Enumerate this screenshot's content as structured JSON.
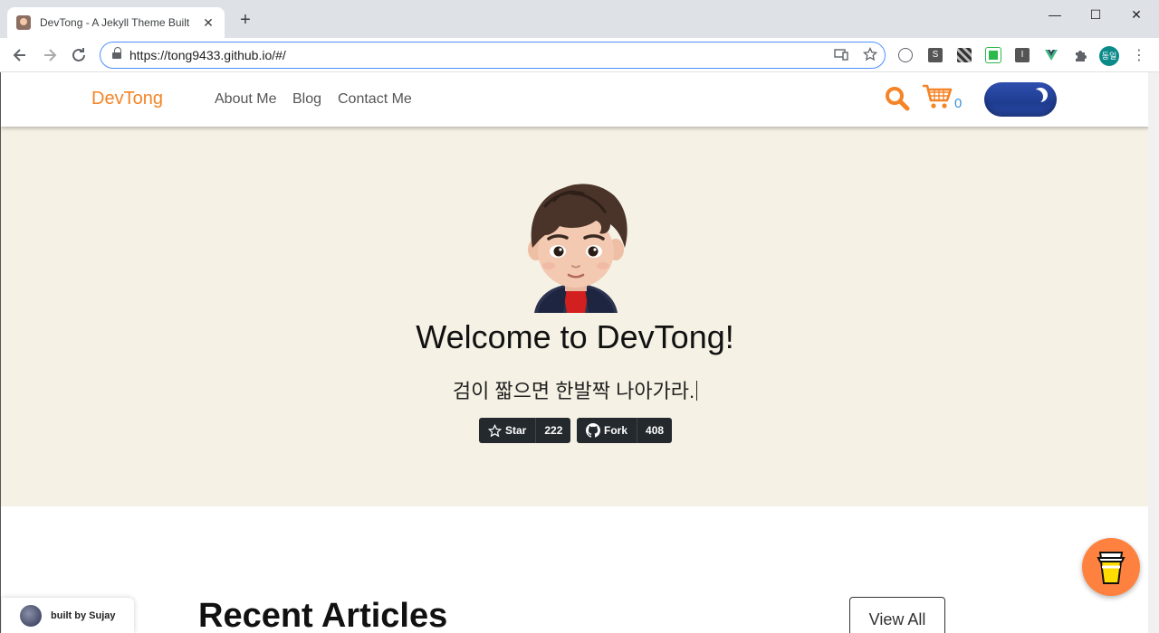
{
  "browser": {
    "tab_title": "DevTong - A Jekyll Theme Built",
    "tab_close": "✕",
    "new_tab": "+",
    "url": "https://tong9433.github.io/#/",
    "window_minimize": "—",
    "window_maximize": "☐",
    "window_close": "✕",
    "profile_initials": "동일",
    "extensions": [
      {
        "icon": "circle-icon",
        "label": ""
      },
      {
        "icon": "s-extension-icon",
        "label": "S"
      },
      {
        "icon": "stripe-extension-icon",
        "label": ""
      },
      {
        "icon": "green-extension-icon",
        "label": ""
      },
      {
        "icon": "i-extension-icon",
        "label": "I"
      },
      {
        "icon": "vue-extension-icon",
        "label": ""
      },
      {
        "icon": "puzzle-icon",
        "label": ""
      }
    ]
  },
  "site": {
    "brand": "DevTong",
    "nav": [
      "About Me",
      "Blog",
      "Contact Me"
    ],
    "cart_count": "0",
    "theme": "dark-toggle"
  },
  "hero": {
    "title": "Welcome to DevTong!",
    "subtitle": "검이 짧으면 한발짝 나아가라.",
    "star_label": "Star",
    "star_count": "222",
    "fork_label": "Fork",
    "fork_count": "408"
  },
  "recent": {
    "heading": "Recent Articles",
    "view_all": "View All"
  },
  "footer": {
    "built_by": "built by Sujay"
  },
  "colors": {
    "brand": "#f58426",
    "hero_bg": "#f5f1e4",
    "cart_count": "#3b8fd6",
    "toggle": "#2f4fb0",
    "coffee": "#ff813f"
  }
}
